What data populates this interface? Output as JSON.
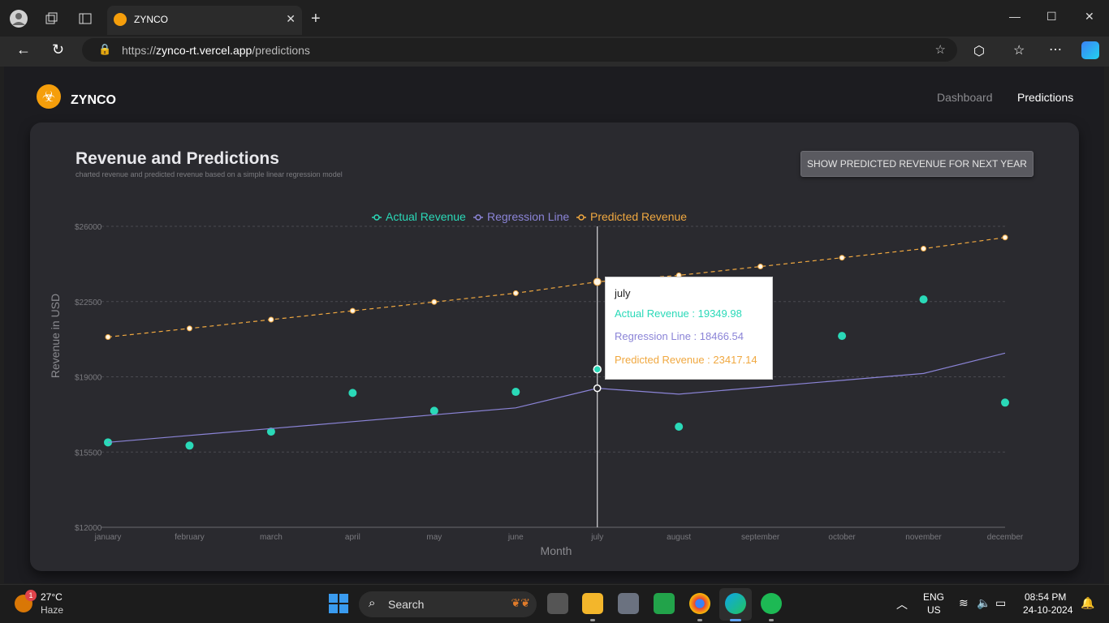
{
  "browser": {
    "tab_title": "ZYNCO",
    "url_scheme": "https://",
    "url_host": "zynco-rt.vercel.app",
    "url_path": "/predictions"
  },
  "site": {
    "brand": "ZYNCO",
    "nav": [
      {
        "label": "Dashboard",
        "active": false
      },
      {
        "label": "Predictions",
        "active": true
      }
    ]
  },
  "card": {
    "title": "Revenue and Predictions",
    "subtitle": "charted revenue and predicted revenue based on a simple linear regression model",
    "button_label": "SHOW PREDICTED REVENUE FOR NEXT YEAR"
  },
  "chart_data": {
    "type": "line",
    "xlabel": "Month",
    "ylabel": "Revenue in USD",
    "ylim": [
      12000,
      26000
    ],
    "y_ticks": [
      "$12000",
      "$15500",
      "$19000",
      "$22500",
      "$26000"
    ],
    "y_tick_values": [
      12000,
      15500,
      19000,
      22500,
      26000
    ],
    "categories": [
      "january",
      "february",
      "march",
      "april",
      "may",
      "june",
      "july",
      "august",
      "september",
      "october",
      "november",
      "december"
    ],
    "grid": true,
    "legend_position": "top",
    "series": [
      {
        "name": "Actual Revenue",
        "color": "#2ad9b8",
        "style": "scatter",
        "values": [
          15950,
          15800,
          16450,
          18250,
          17420,
          18300,
          19349.98,
          16680,
          null,
          20900,
          22600,
          17800
        ]
      },
      {
        "name": "Regression Line",
        "color": "#8b84d7",
        "style": "solid",
        "values": [
          15950,
          16270.6,
          16591.2,
          16911.9,
          17232.5,
          17553.1,
          18466.54,
          18194.3,
          18514.9,
          18835.5,
          19156.1,
          20100
        ]
      },
      {
        "name": "Predicted Revenue",
        "color": "#f0a840",
        "style": "dashed",
        "values": [
          20850,
          21250,
          21660,
          22070,
          22480,
          22890,
          23417.14,
          23720,
          24130,
          24540,
          24960,
          25480
        ]
      }
    ],
    "hover_index": 6
  },
  "tooltip": {
    "title": "july",
    "rows": [
      {
        "label": "Actual Revenue : 19349.98",
        "color": "#2ad9b8"
      },
      {
        "label": "Regression Line : 18466.54",
        "color": "#8b84d7"
      },
      {
        "label": "Predicted Revenue : 23417.14",
        "color": "#f0a840"
      }
    ]
  },
  "taskbar": {
    "weather_temp": "27°C",
    "weather_cond": "Haze",
    "weather_badge": "1",
    "search_label": "Search",
    "lang": "ENG",
    "region": "US",
    "time": "08:54 PM",
    "date": "24-10-2024"
  }
}
